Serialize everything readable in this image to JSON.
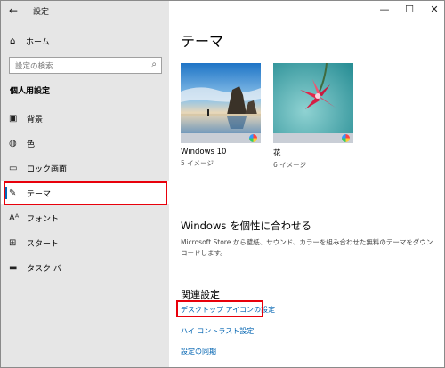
{
  "app": {
    "title": "設定"
  },
  "sidebar": {
    "home_label": "ホーム",
    "search_placeholder": "設定の検索",
    "section_title": "個人用設定",
    "items": [
      {
        "label": "背景",
        "icon": "picture-icon"
      },
      {
        "label": "色",
        "icon": "palette-icon"
      },
      {
        "label": "ロック画面",
        "icon": "lock-screen-icon"
      },
      {
        "label": "テーマ",
        "icon": "theme-icon",
        "selected": true
      },
      {
        "label": "フォント",
        "icon": "font-icon"
      },
      {
        "label": "スタート",
        "icon": "start-icon"
      },
      {
        "label": "タスク バー",
        "icon": "taskbar-icon"
      }
    ]
  },
  "main": {
    "title": "テーマ",
    "themes": [
      {
        "name": "Windows 10",
        "count": "5 イメージ"
      },
      {
        "name": "花",
        "count": "6 イメージ"
      }
    ],
    "personalize_heading": "Windows を個性に合わせる",
    "personalize_desc": "Microsoft Store から壁紙、サウンド、カラーを組み合わせた無料のテーマをダウンロードします。",
    "related_heading": "関連設定",
    "related_links": [
      "デスクトップ アイコンの設定",
      "ハイ コントラスト設定",
      "設定の同期"
    ]
  },
  "colors": {
    "accent": "#0067b8",
    "highlight": "#e8000b",
    "link": "#0063b1"
  }
}
